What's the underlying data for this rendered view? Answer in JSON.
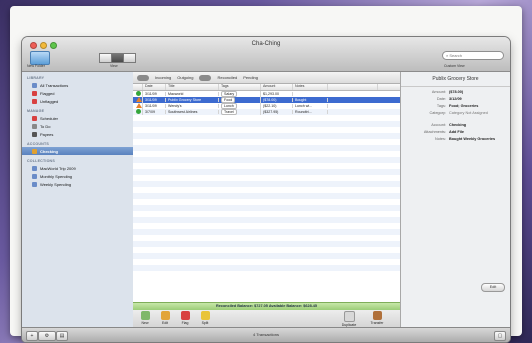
{
  "window": {
    "title": "Cha-Ching"
  },
  "toolbar": {
    "new_folder_label": "New Folder",
    "view_label": "View",
    "search_placeholder": "Search",
    "custom_view_label": "Custom View"
  },
  "sidebar": {
    "sections": [
      {
        "header": "LIBRARY",
        "items": [
          {
            "label": "All Transactions",
            "icon": "list-icon",
            "color": "#6a8cc8"
          },
          {
            "label": "Flagged",
            "icon": "flag-icon",
            "color": "#d84141"
          },
          {
            "label": "Unflagged",
            "icon": "flag-outline-icon",
            "color": "#d84141"
          }
        ]
      },
      {
        "header": "MANAGE",
        "items": [
          {
            "label": "Scheduler",
            "icon": "calendar-icon",
            "color": "#d84141"
          },
          {
            "label": "To Do",
            "icon": "checklist-icon",
            "color": "#888888"
          },
          {
            "label": "Payees",
            "icon": "person-icon",
            "color": "#555555"
          }
        ]
      },
      {
        "header": "ACCOUNTS",
        "items": [
          {
            "label": "Checking",
            "icon": "bank-icon",
            "color": "#e0a030",
            "selected": true
          }
        ]
      },
      {
        "header": "COLLECTIONS",
        "items": [
          {
            "label": "MacWorld Trip 2009",
            "icon": "collection-icon",
            "color": "#6a8cc8"
          },
          {
            "label": "Monthly Spending",
            "icon": "collection-icon",
            "color": "#6a8cc8"
          },
          {
            "label": "Weekly Spending",
            "icon": "collection-icon",
            "color": "#6a8cc8"
          }
        ]
      }
    ]
  },
  "filters": [
    "Incoming",
    "Outgoing",
    "Reconciled",
    "Pending"
  ],
  "table": {
    "columns": [
      "Date",
      "Title",
      "Tags",
      "Amount",
      "Notes"
    ],
    "rows": [
      {
        "status": "ok",
        "date": "3/11/09",
        "title": "Macworld",
        "tag": "Salary",
        "amount": "$1,293.00",
        "notes": ""
      },
      {
        "status": "warn",
        "date": "3/11/09",
        "title": "Publix Grocery Store",
        "tag": "Food",
        "amount": "($78.00)",
        "notes": "Bought",
        "selected": true
      },
      {
        "status": "warn",
        "date": "3/11/09",
        "title": "Wendy's",
        "tag": "Lunch",
        "amount": "($22.10)",
        "notes": "Lunch wi..."
      },
      {
        "status": "ok",
        "date": "3/7/09",
        "title": "Southwest Airlines",
        "tag": "Travel",
        "amount": "($327.95)",
        "notes": "Roundtri..."
      }
    ]
  },
  "balance": {
    "text": "Reconciled Balance: $727.05    Available Balance: $628.45"
  },
  "actions": {
    "new": "New",
    "edit": "Edit",
    "flag": "Flag",
    "split": "Split",
    "duplicate": "Duplicate",
    "transfer": "Transfer"
  },
  "detail": {
    "title": "Publix Grocery Store",
    "fields": [
      {
        "key": "Amount:",
        "value": "($78.00)"
      },
      {
        "key": "Date:",
        "value": "3/12/09"
      },
      {
        "key": "Tags:",
        "value": "Food; Groceries"
      },
      {
        "key": "Category:",
        "value": "Category Not Assigned"
      },
      {
        "key": "Account:",
        "value": "Checking"
      },
      {
        "key": "Attachments:",
        "value": "Add File"
      },
      {
        "key": "Notes:",
        "value": "Bought Weekly Groceries"
      }
    ],
    "edit_label": "Edit"
  },
  "status": {
    "count_label": "4 Transactions"
  }
}
